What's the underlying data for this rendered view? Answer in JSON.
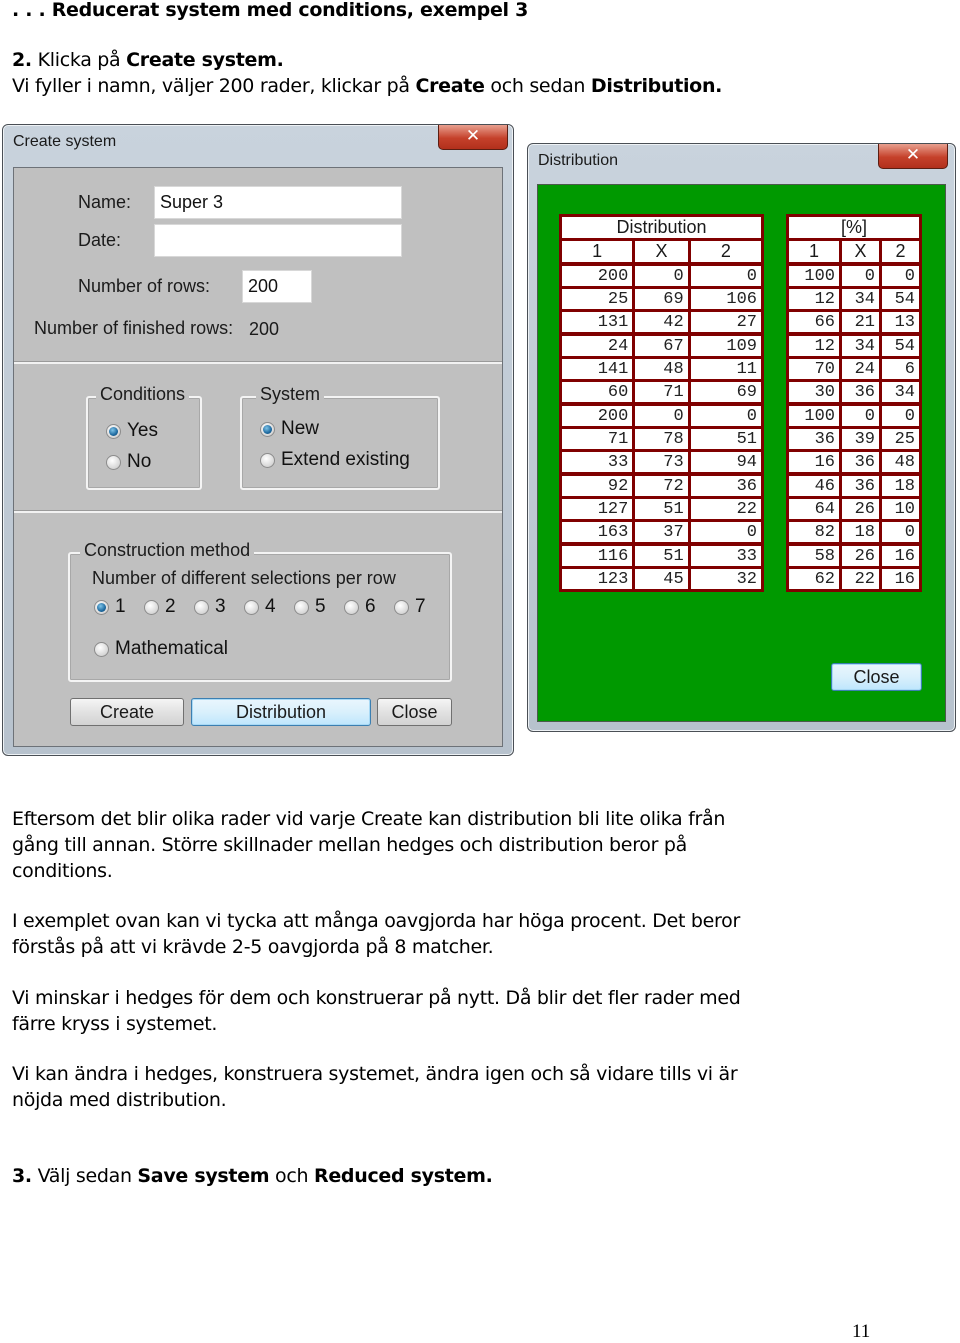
{
  "document": {
    "heading": ". . . Reducerat system med conditions, exempel 3",
    "step2": {
      "number": "2.",
      "text_before": " Klicka på ",
      "bold": "Create system."
    },
    "step2_line2": {
      "text1": "Vi fyller i namn, väljer 200 rader, klickar på ",
      "bold1": "Create",
      "text2": " och sedan ",
      "bold2": "Distribution."
    },
    "paragraphs": [
      [
        "Eftersom det blir olika rader vid varje Create kan distribution bli lite olika från",
        "gång till annan. Större skillnader mellan hedges och distribution beror på",
        "conditions."
      ],
      [
        "I exemplet ovan kan vi tycka att många oavgjorda har höga procent. Det beror",
        "förstås på att vi krävde 2-5 oavgjorda på 8 matcher."
      ],
      [
        "Vi minskar i hedges för dem och konstruerar på nytt. Då blir det fler rader med",
        "färre kryss i systemet."
      ],
      [
        "Vi kan ändra i hedges, konstruera systemet, ändra igen och så vidare tills vi är",
        "nöjda med distribution."
      ]
    ],
    "step3": {
      "number": "3.",
      "text1": " Välj sedan ",
      "bold1": "Save system",
      "text2": " och ",
      "bold2": "Reduced system."
    },
    "page_number": "11"
  },
  "create_system": {
    "title": "Create system",
    "close_glyph": "✕",
    "name_label": "Name:",
    "name_value": "Super 3",
    "date_label": "Date:",
    "date_value": "",
    "rows_label": "Number of rows:",
    "rows_value": "200",
    "finished_label": "Number of finished rows:",
    "finished_value": "200",
    "conditions": {
      "legend": "Conditions",
      "options": [
        {
          "label": "Yes",
          "selected": true
        },
        {
          "label": "No",
          "selected": false
        }
      ]
    },
    "system": {
      "legend": "System",
      "options": [
        {
          "label": "New",
          "selected": true
        },
        {
          "label": "Extend existing",
          "selected": false
        }
      ]
    },
    "construction": {
      "legend": "Construction method",
      "subtitle": "Number of different selections per row",
      "selections": [
        {
          "label": "1",
          "selected": true
        },
        {
          "label": "2",
          "selected": false
        },
        {
          "label": "3",
          "selected": false
        },
        {
          "label": "4",
          "selected": false
        },
        {
          "label": "5",
          "selected": false
        },
        {
          "label": "6",
          "selected": false
        },
        {
          "label": "7",
          "selected": false
        }
      ],
      "mathematical": {
        "label": "Mathematical",
        "selected": false
      }
    },
    "buttons": {
      "create": "Create",
      "distribution": "Distribution",
      "close": "Close"
    }
  },
  "distribution_window": {
    "title": "Distribution",
    "close_glyph": "✕",
    "background_color": "#009900",
    "border_color": "#800000",
    "counts_table": {
      "title": "Distribution",
      "headers": [
        "1",
        "X",
        "2"
      ],
      "rows": [
        [
          "200",
          "0",
          "0"
        ],
        [
          "25",
          "69",
          "106"
        ],
        [
          "131",
          "42",
          "27"
        ],
        [
          "24",
          "67",
          "109"
        ],
        [
          "141",
          "48",
          "11"
        ],
        [
          "60",
          "71",
          "69"
        ],
        [
          "200",
          "0",
          "0"
        ],
        [
          "71",
          "78",
          "51"
        ],
        [
          "33",
          "73",
          "94"
        ],
        [
          "92",
          "72",
          "36"
        ],
        [
          "127",
          "51",
          "22"
        ],
        [
          "163",
          "37",
          "0"
        ],
        [
          "116",
          "51",
          "33"
        ],
        [
          "123",
          "45",
          "32"
        ]
      ]
    },
    "percent_table": {
      "title": "[%]",
      "headers": [
        "1",
        "X",
        "2"
      ],
      "rows": [
        [
          "100",
          "0",
          "0"
        ],
        [
          "12",
          "34",
          "54"
        ],
        [
          "66",
          "21",
          "13"
        ],
        [
          "12",
          "34",
          "54"
        ],
        [
          "70",
          "24",
          "6"
        ],
        [
          "30",
          "36",
          "34"
        ],
        [
          "100",
          "0",
          "0"
        ],
        [
          "36",
          "39",
          "25"
        ],
        [
          "16",
          "36",
          "48"
        ],
        [
          "46",
          "36",
          "18"
        ],
        [
          "64",
          "26",
          "10"
        ],
        [
          "82",
          "18",
          "0"
        ],
        [
          "58",
          "26",
          "16"
        ],
        [
          "62",
          "22",
          "16"
        ]
      ]
    },
    "close_button": "Close"
  }
}
